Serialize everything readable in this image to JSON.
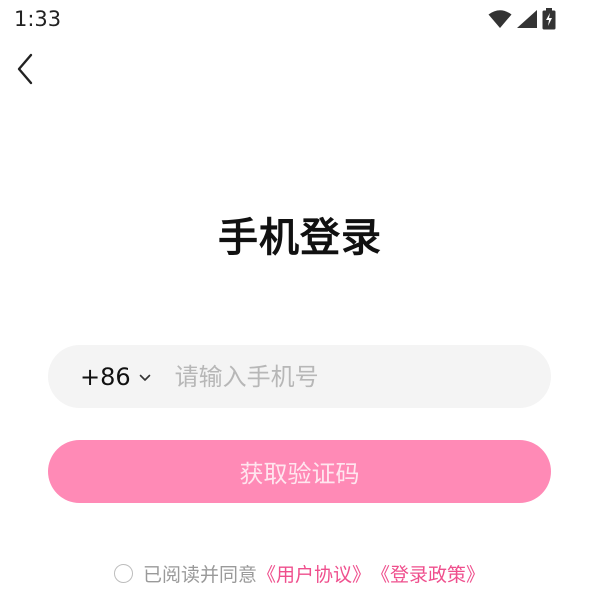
{
  "status_bar": {
    "time": "1:33",
    "icons": [
      "wifi-icon",
      "signal-icon",
      "battery-charging-icon"
    ]
  },
  "nav": {
    "back_icon": "chevron-left-icon"
  },
  "title": "手机登录",
  "phone": {
    "country_code": "+86",
    "dropdown_icon": "chevron-down-icon",
    "placeholder": "请输入手机号",
    "value": ""
  },
  "get_code_button": "获取验证码",
  "agreement": {
    "prefix": "已阅读并同意",
    "user_agreement": "《用户协议》",
    "login_policy": "《登录政策》",
    "checked": false
  },
  "colors": {
    "accent": "#ff8ab6",
    "link": "#ef4f8d",
    "input_bg": "#f4f4f4"
  }
}
